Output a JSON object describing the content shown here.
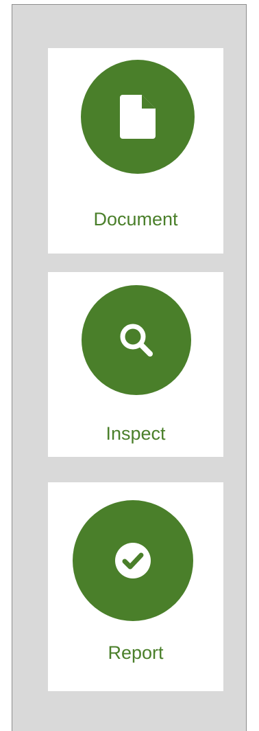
{
  "colors": {
    "accent": "#4a7f2a",
    "panel_background": "#d9d9d9",
    "card_background": "#ffffff"
  },
  "steps": [
    {
      "label": "Document",
      "icon": "document-icon"
    },
    {
      "label": "Inspect",
      "icon": "search-icon"
    },
    {
      "label": "Report",
      "icon": "check-circle-icon"
    }
  ]
}
